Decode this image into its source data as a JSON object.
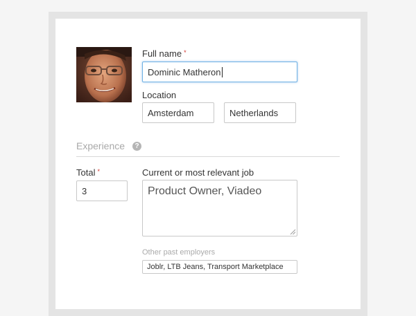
{
  "profile": {
    "full_name_label": "Full name",
    "required_mark": "*",
    "full_name_value": "Dominic Matheron",
    "location_label": "Location",
    "city_value": "Amsterdam",
    "country_value": "Netherlands"
  },
  "experience": {
    "section_title": "Experience",
    "help_icon_glyph": "?",
    "total_label": "Total",
    "total_value": "3",
    "current_job_label": "Current or most relevant job",
    "current_job_value": "Product Owner, Viadeo",
    "past_employers_label": "Other past employers",
    "past_employers_value": "Joblr, LTB Jeans, Transport Marketplace"
  },
  "colors": {
    "required": "#d0342c",
    "focus_border": "#6fb1e4",
    "muted_text": "#a9a9a9"
  }
}
